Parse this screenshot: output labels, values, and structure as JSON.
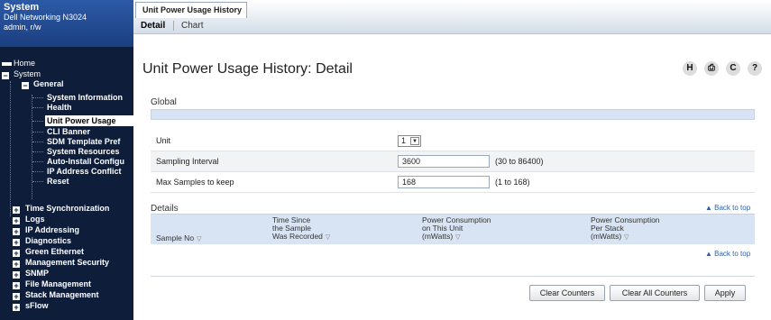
{
  "sidebar": {
    "header": {
      "title": "System",
      "device": "Dell Networking N3024",
      "user": "admin, r/w"
    },
    "items": [
      {
        "label": "Home"
      },
      {
        "label": "System"
      },
      {
        "label": "General"
      },
      {
        "label": "System Information"
      },
      {
        "label": "Health"
      },
      {
        "label": "Unit Power Usage"
      },
      {
        "label": "CLI Banner"
      },
      {
        "label": "SDM Template Pref"
      },
      {
        "label": "System Resources"
      },
      {
        "label": "Auto-Install Configu"
      },
      {
        "label": "IP Address Conflict"
      },
      {
        "label": "Reset"
      },
      {
        "label": "Time Synchronization"
      },
      {
        "label": "Logs"
      },
      {
        "label": "IP Addressing"
      },
      {
        "label": "Diagnostics"
      },
      {
        "label": "Green Ethernet"
      },
      {
        "label": "Management Security"
      },
      {
        "label": "SNMP"
      },
      {
        "label": "File Management"
      },
      {
        "label": "Stack Management"
      },
      {
        "label": "sFlow"
      }
    ]
  },
  "tabs": {
    "main": "Unit Power Usage History",
    "detail": "Detail",
    "chart": "Chart"
  },
  "page_title": "Unit Power Usage History: Detail",
  "toolbar": {
    "save": "H",
    "print": "⎙",
    "refresh": "C",
    "help": "?"
  },
  "global": {
    "section": "Global",
    "unit_label": "Unit",
    "unit_value": "1",
    "sampling_label": "Sampling Interval",
    "sampling_value": "3600",
    "sampling_hint": "(30 to 86400)",
    "max_label": "Max Samples to keep",
    "max_value": "168",
    "max_hint": "(1 to 168)"
  },
  "details": {
    "section": "Details",
    "back_to_top": "Back to top",
    "columns": [
      {
        "line1": "",
        "line2": "",
        "line3": "Sample No"
      },
      {
        "line1": "Time Since",
        "line2": "the Sample",
        "line3": "Was Recorded"
      },
      {
        "line1": "Power Consumption",
        "line2": "on This Unit",
        "line3": "(mWatts)"
      },
      {
        "line1": "Power Consumption",
        "line2": "Per Stack",
        "line3": "(mWatts)"
      }
    ]
  },
  "buttons": {
    "clear": "Clear Counters",
    "clear_all": "Clear All Counters",
    "apply": "Apply"
  }
}
